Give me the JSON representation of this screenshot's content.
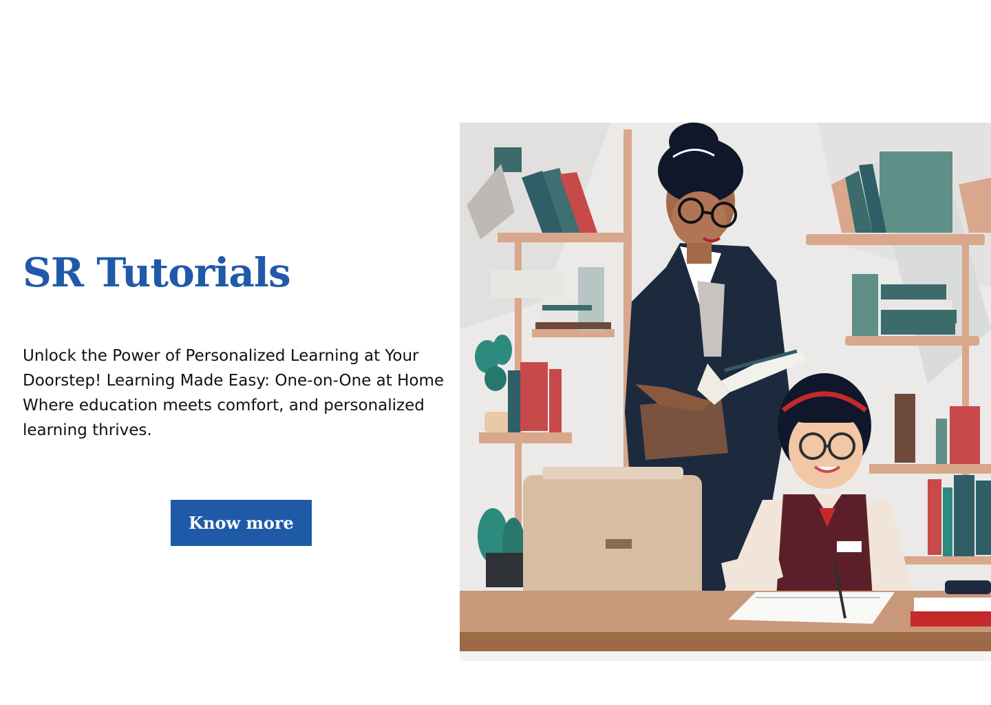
{
  "hero": {
    "title": "SR Tutorials",
    "description_lines": [
      "Unlock the Power of Personalized Learning at  Your",
      "Doorstep!  Learning Made Easy: One-on-One at Home",
      "Where education meets comfort, and personalized",
      "learning thrives."
    ],
    "cta_label": "Know more"
  },
  "illustration": {
    "subject": "tutor-with-student-illustration"
  },
  "colors": {
    "brand_blue": "#1f5aa9",
    "text": "#111111",
    "background": "#ffffff"
  }
}
